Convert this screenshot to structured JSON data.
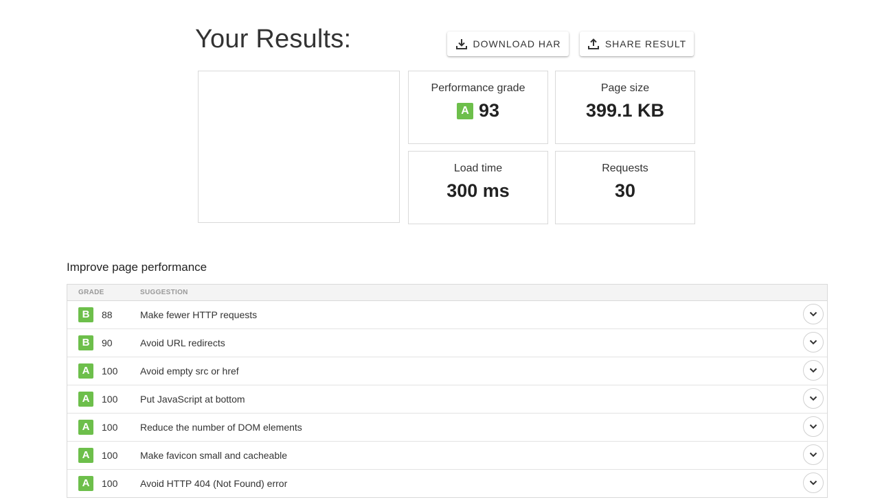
{
  "header": {
    "title": "Your Results:",
    "download_label": "DOWNLOAD HAR",
    "share_label": "SHARE RESULT"
  },
  "metrics": {
    "grade": {
      "label": "Performance grade",
      "letter": "A",
      "value": "93"
    },
    "size": {
      "label": "Page size",
      "value": "399.1 KB"
    },
    "load": {
      "label": "Load time",
      "value": "300 ms"
    },
    "requests": {
      "label": "Requests",
      "value": "30"
    }
  },
  "improve": {
    "heading": "Improve page performance",
    "col_grade": "GRADE",
    "col_suggestion": "SUGGESTION",
    "rows": [
      {
        "letter": "B",
        "score": "88",
        "suggestion": "Make fewer HTTP requests"
      },
      {
        "letter": "B",
        "score": "90",
        "suggestion": "Avoid URL redirects"
      },
      {
        "letter": "A",
        "score": "100",
        "suggestion": "Avoid empty src or href"
      },
      {
        "letter": "A",
        "score": "100",
        "suggestion": "Put JavaScript at bottom"
      },
      {
        "letter": "A",
        "score": "100",
        "suggestion": "Reduce the number of DOM elements"
      },
      {
        "letter": "A",
        "score": "100",
        "suggestion": "Make favicon small and cacheable"
      },
      {
        "letter": "A",
        "score": "100",
        "suggestion": "Avoid HTTP 404 (Not Found) error"
      }
    ]
  },
  "icons": {
    "download": "download-icon",
    "share": "share-icon",
    "expand": "chevron-down-icon"
  },
  "colors": {
    "grade_green": "#6dbf4b",
    "border": "#d9d9d9"
  }
}
